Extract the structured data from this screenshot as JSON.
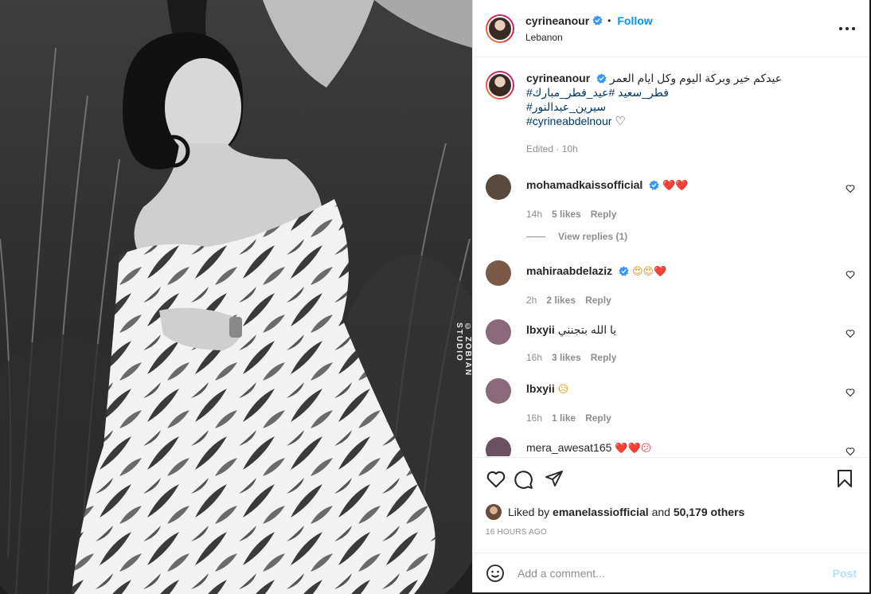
{
  "post": {
    "username": "cyrineanour",
    "location": "Lebanon",
    "follow_label": "Follow",
    "dot": "•",
    "watermark": "© ZOBIAN STUDIO"
  },
  "caption": {
    "username": "cyrineanour",
    "text_line1": "عيدكم خير وبركة اليوم وكل ايام العمر",
    "tags_line2": "#فطر_سعيد #عيد_فطر_مبارك",
    "tags_line3": "#سيرين_عبدالنور",
    "tags_line4": "#cyrineabdelnour",
    "heart": "♡",
    "meta": "Edited · 10h"
  },
  "comments": [
    {
      "username": "mohamadkaissofficial",
      "verified": true,
      "text": "❤️❤️",
      "time": "14h",
      "likes": "5 likes",
      "reply": "Reply",
      "avatar_color": "#5a4a3e"
    },
    {
      "username": "mahiraabdelaziz",
      "verified": true,
      "text": "😍😍❤️",
      "time": "2h",
      "likes": "2 likes",
      "reply": "Reply",
      "avatar_color": "#7a5a46"
    },
    {
      "username": "lbxyii",
      "verified": false,
      "text": "يا الله بتجنني",
      "time": "16h",
      "likes": "3 likes",
      "reply": "Reply",
      "avatar_color": "#8a6a7a"
    },
    {
      "username": "lbxyii",
      "verified": false,
      "text": "😥",
      "time": "16h",
      "likes": "1 like",
      "reply": "Reply",
      "avatar_color": "#8a6a7a"
    },
    {
      "username": "mera_awesat165",
      "verified": false,
      "text": "❤️❤️😕",
      "time": "",
      "likes": "",
      "reply": "",
      "avatar_color": "#6a5060"
    }
  ],
  "view_replies": "View replies (1)",
  "likes": {
    "prefix": "Liked by",
    "user": "emanelassiofficial",
    "and": "and",
    "others": "50,179 others"
  },
  "time_ago": "16 HOURS AGO",
  "add_comment": {
    "placeholder": "Add a comment...",
    "post_label": "Post"
  },
  "colors": {
    "accent": "#0095f6",
    "tag": "#00376b",
    "heart_red": "#ed4956"
  }
}
